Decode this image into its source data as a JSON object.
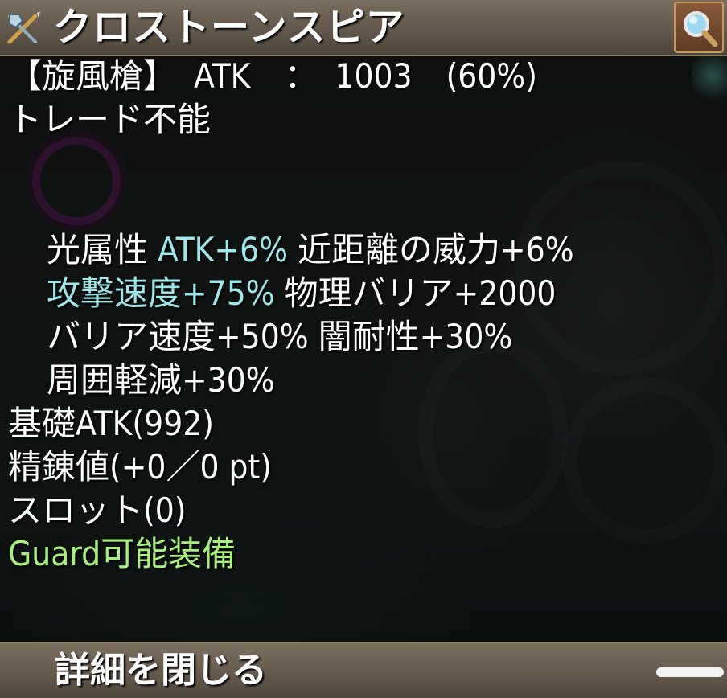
{
  "title_bar": {
    "item_name": "クロストーンスピア",
    "weapon_icon": "spear-axe-icon",
    "search_icon": "magnifier-icon"
  },
  "item": {
    "type_line": "【旋風槍】　ATK　：　1003　(60%)",
    "trade": "トレード不能",
    "stats": [
      [
        {
          "text": "光属性 ",
          "style": "white"
        },
        {
          "text": "ATK+6%",
          "style": "cyan"
        },
        {
          "text": " 近距離の威力+6%",
          "style": "white"
        }
      ],
      [
        {
          "text": "攻撃速度+75%",
          "style": "cyan"
        },
        {
          "text": " 物理バリア+2000",
          "style": "white"
        }
      ],
      [
        {
          "text": "バリア速度+50% 闇耐性+30%",
          "style": "white"
        }
      ],
      [
        {
          "text": "周囲軽減+30%",
          "style": "white"
        }
      ]
    ],
    "base_atk": "基礎ATK(992)",
    "refine": "精錬値(+0／0 pt)",
    "slot": "スロット(0)",
    "guard": "Guard可能装備"
  },
  "footer": {
    "close_label": "詳細を閉じる"
  },
  "colors": {
    "cyan_text": "#9fe6ea",
    "green_text": "#a8f07e",
    "bar_brown": "#6b5f50"
  }
}
